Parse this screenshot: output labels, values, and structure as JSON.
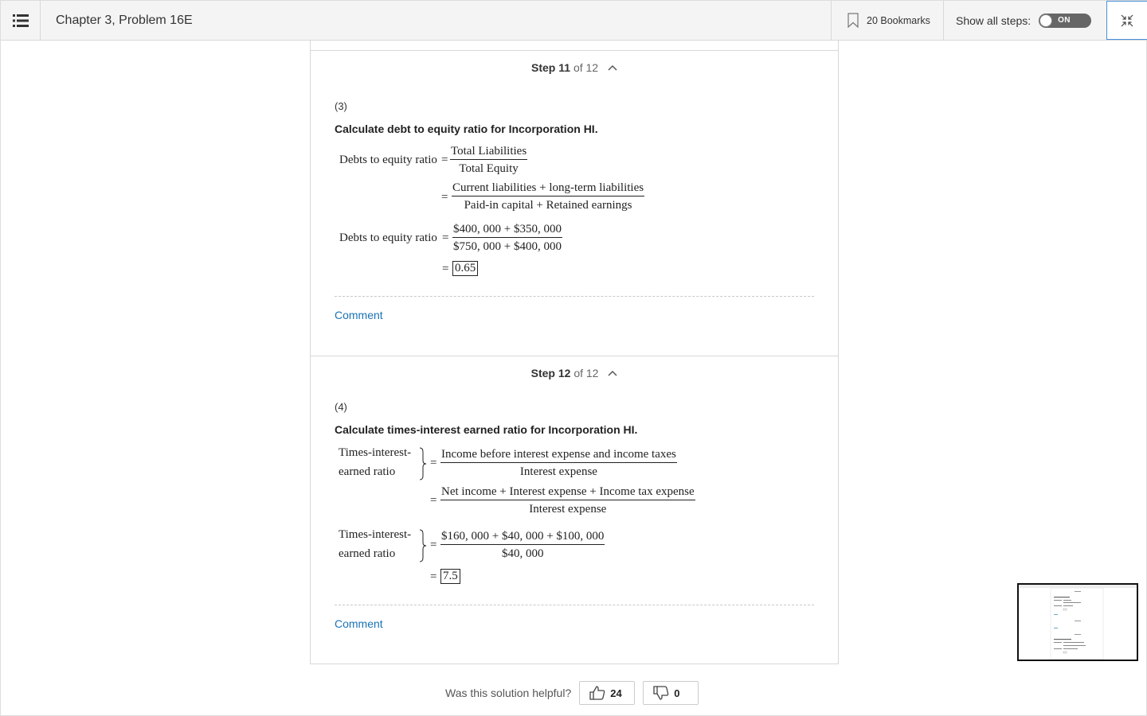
{
  "header": {
    "chapter_title": "Chapter 3, Problem 16E",
    "bookmarks_label": "20 Bookmarks",
    "show_steps_label": "Show all steps:",
    "toggle_label": "ON"
  },
  "step11": {
    "step_word": "Step",
    "step_number": "11",
    "of_total": "of 12",
    "part": "(3)",
    "heading": "Calculate debt to equity ratio for Incorporation HI.",
    "lhs1": "Debts to equity ratio",
    "f1_num": "Total Liabilities",
    "f1_den": "Total Equity",
    "f2_num": "Current liabilities + long-term liabilities",
    "f2_den": "Paid-in capital + Retained earnings",
    "lhs2": "Debts to equity ratio",
    "f3_num": "$400, 000 + $350, 000",
    "f3_den": "$750, 000 + $400, 000",
    "result": "0.65",
    "comment": "Comment"
  },
  "step12": {
    "step_word": "Step",
    "step_number": "12",
    "of_total": "of 12",
    "part": "(4)",
    "heading": "Calculate times-interest earned ratio for Incorporation HI.",
    "lhs1_line1": "Times-interest-",
    "lhs1_line2": "earned ratio",
    "f1_num": "Income before interest expense and income taxes",
    "f1_den": "Interest expense",
    "f2_num": "Net income + Interest expense + Income tax expense",
    "f2_den": "Interest expense",
    "lhs2_line1": "Times-interest-",
    "lhs2_line2": "earned ratio",
    "f3_num": "$160, 000 + $40, 000 + $100, 000",
    "f3_den": "$40, 000",
    "result": "7.5",
    "comment": "Comment"
  },
  "feedback": {
    "question": "Was this solution helpful?",
    "upvotes": "24",
    "downvotes": "0"
  },
  "icons": {
    "menu": "list-menu-icon",
    "bookmark": "bookmark-icon",
    "collapse": "collapse-arrows-icon",
    "chevron": "chevron-up-icon",
    "thumbs_up": "thumbs-up-icon",
    "thumbs_down": "thumbs-down-icon"
  }
}
